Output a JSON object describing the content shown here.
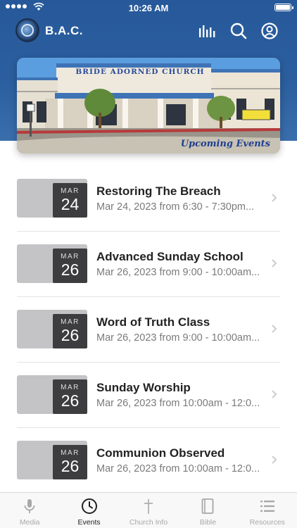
{
  "status_bar": {
    "time": "10:26 AM"
  },
  "header": {
    "title": "B.A.C.",
    "icons": [
      "logo-icon",
      "stats-icon",
      "search-icon",
      "profile-icon"
    ]
  },
  "banner": {
    "sign_text": "BRIDE ADORNED CHURCH",
    "caption": "Upcoming Events",
    "colors": {
      "sky": "#5fa3e0",
      "building": "#efe9dd",
      "trim": "#3e73b5"
    }
  },
  "events": [
    {
      "month": "MAR",
      "day": "24",
      "title": "Restoring The Breach",
      "subtitle": "Mar 24, 2023 from 6:30 - 7:30pm..."
    },
    {
      "month": "MAR",
      "day": "26",
      "title": "Advanced Sunday School",
      "subtitle": "Mar 26, 2023 from 9:00 - 10:00am..."
    },
    {
      "month": "MAR",
      "day": "26",
      "title": "Word of Truth Class",
      "subtitle": "Mar 26, 2023 from 9:00 - 10:00am..."
    },
    {
      "month": "MAR",
      "day": "26",
      "title": "Sunday Worship",
      "subtitle": "Mar 26, 2023 from 10:00am - 12:0..."
    },
    {
      "month": "MAR",
      "day": "26",
      "title": "Communion Observed",
      "subtitle": "Mar 26, 2023 from 10:00am - 12:0..."
    }
  ],
  "tabs": [
    {
      "label": "Media",
      "icon": "microphone-icon",
      "active": false
    },
    {
      "label": "Events",
      "icon": "clock-icon",
      "active": true
    },
    {
      "label": "Church Info",
      "icon": "cross-icon",
      "active": false
    },
    {
      "label": "Bible",
      "icon": "book-icon",
      "active": false
    },
    {
      "label": "Resources",
      "icon": "list-icon",
      "active": false
    }
  ],
  "colors": {
    "header": "#2c5f9f",
    "date_box": "#3d3d3f",
    "thumb": "#c4c4c7",
    "tab_active": "#222222",
    "tab_inactive": "#a8a8a8"
  }
}
